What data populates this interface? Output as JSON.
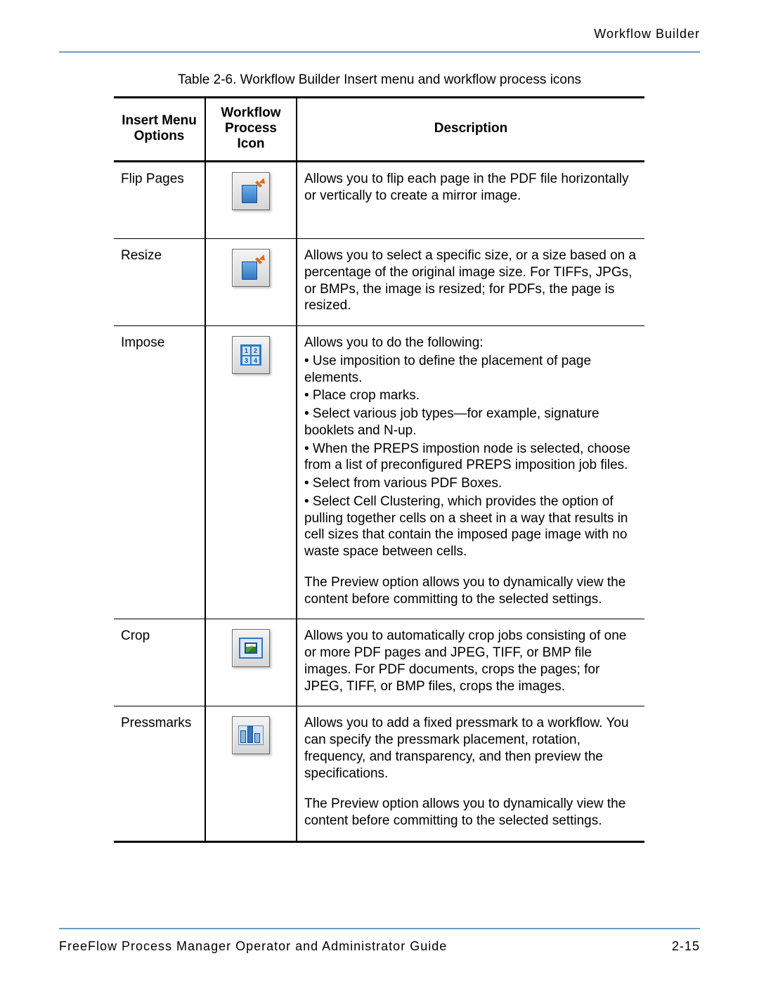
{
  "header": {
    "running_title": "Workflow Builder"
  },
  "caption": "Table 2-6.  Workflow Builder Insert menu and workflow process icons",
  "columns": {
    "col1_line1": "Insert Menu",
    "col1_line2": "Options",
    "col2_line1": "Workflow",
    "col2_line2": "Process Icon",
    "col3": "Description"
  },
  "rows": [
    {
      "option": "Flip Pages",
      "icon": "flip-pages-icon",
      "desc_lines": [
        "Allows you to flip each page in the PDF file horizontally or vertically to create a mirror image."
      ]
    },
    {
      "option": "Resize",
      "icon": "resize-icon",
      "desc_lines": [
        "Allows you to select a specific size, or a size based on a percentage of the original image size. For TIFFs, JPGs, or BMPs, the image is resized; for PDFs, the page is resized."
      ]
    },
    {
      "option": "Impose",
      "icon": "impose-icon",
      "desc_lines": [
        "Allows you to do the following:",
        "• Use imposition to define the placement of page elements.",
        "• Place crop marks.",
        "• Select various job types—for example, signature booklets and N-up.",
        "• When the PREPS impostion node is selected, choose from a list of preconfigured PREPS imposition job files.",
        "• Select from various PDF Boxes.",
        "• Select Cell Clustering, which provides the option of pulling together cells on a sheet in a way that results in cell sizes that contain the imposed page image with no waste space between cells."
      ],
      "desc_extra": [
        "The Preview option allows you to dynamically view the content before committing to the selected settings."
      ]
    },
    {
      "option": "Crop",
      "icon": "crop-icon",
      "desc_lines": [
        "Allows you to automatically crop jobs consisting of one or more PDF pages and JPEG, TIFF, or BMP file images. For PDF documents, crops the pages; for JPEG, TIFF, or BMP files, crops the images."
      ]
    },
    {
      "option": "Pressmarks",
      "icon": "pressmarks-icon",
      "desc_lines": [
        "Allows you to add a fixed pressmark to a workflow. You can specify the pressmark placement, rotation, frequency, and transparency, and then preview the specifications."
      ],
      "desc_extra": [
        "The Preview option allows you to dynamically view the content before committing to the selected settings."
      ]
    }
  ],
  "impose_cells": [
    "1",
    "2",
    "3",
    "4"
  ],
  "footer": {
    "left": "FreeFlow Process Manager Operator and Administrator Guide",
    "right": "2-15"
  }
}
